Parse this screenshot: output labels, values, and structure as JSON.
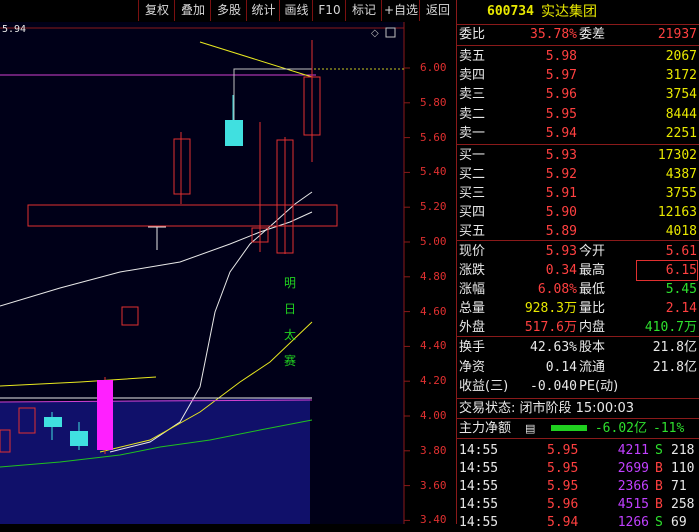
{
  "toolbar": {
    "buttons": [
      "复权",
      "叠加",
      "多股",
      "统计",
      "画线",
      "F10",
      "标记",
      "+自选",
      "返回"
    ]
  },
  "chart": {
    "current_price_label": "5.94",
    "price_ticks": [
      "6.00",
      "5.80",
      "5.60",
      "5.40",
      "5.20",
      "5.00",
      "4.80",
      "4.60",
      "4.40",
      "4.20",
      "4.00",
      "3.80",
      "3.60",
      "3.40"
    ],
    "annotation_chars": [
      "明",
      "日",
      "太",
      "赛"
    ]
  },
  "quote": {
    "code": "600734",
    "name": "实达集团",
    "weibi_label": "委比",
    "weibi_value": "35.78%",
    "weicha_label": "委差",
    "weicha_value": "21937",
    "asks": [
      {
        "label": "卖五",
        "price": "5.98",
        "vol": "2067"
      },
      {
        "label": "卖四",
        "price": "5.97",
        "vol": "3172"
      },
      {
        "label": "卖三",
        "price": "5.96",
        "vol": "3754"
      },
      {
        "label": "卖二",
        "price": "5.95",
        "vol": "8444"
      },
      {
        "label": "卖一",
        "price": "5.94",
        "vol": "2251"
      }
    ],
    "bids": [
      {
        "label": "买一",
        "price": "5.93",
        "vol": "17302"
      },
      {
        "label": "买二",
        "price": "5.92",
        "vol": "4387"
      },
      {
        "label": "买三",
        "price": "5.91",
        "vol": "3755"
      },
      {
        "label": "买四",
        "price": "5.90",
        "vol": "12163"
      },
      {
        "label": "买五",
        "price": "5.89",
        "vol": "4018"
      }
    ],
    "stats": [
      {
        "l1": "现价",
        "v1": "5.93",
        "l2": "今开",
        "v2": "5.61"
      },
      {
        "l1": "涨跌",
        "v1": "0.34",
        "l2": "最高",
        "v2": "6.15"
      },
      {
        "l1": "涨幅",
        "v1": "6.08%",
        "l2": "最低",
        "v2": "5.45"
      },
      {
        "l1": "总量",
        "v1": "928.3万",
        "l2": "量比",
        "v2": "2.14"
      },
      {
        "l1": "外盘",
        "v1": "517.6万",
        "l2": "内盘",
        "v2": "410.7万"
      }
    ],
    "fund": [
      {
        "l1": "换手",
        "v1": "42.63%",
        "l2": "股本",
        "v2": "21.8亿"
      },
      {
        "l1": "净资",
        "v1": "0.14",
        "l2": "流通",
        "v2": "21.8亿"
      },
      {
        "l1": "收益(三)",
        "v1": "-0.040",
        "l2": "PE(动)",
        "v2": ""
      }
    ],
    "trade_status": "交易状态: 闭市阶段 15:00:03",
    "main_flow_label": "主力净额",
    "main_flow_value": "-6.02亿",
    "main_flow_pct": "-11%",
    "ticks": [
      {
        "time": "14:55",
        "price": "5.95",
        "vol": "4211",
        "side": "S",
        "n": "218"
      },
      {
        "time": "14:55",
        "price": "5.95",
        "vol": "2699",
        "side": "B",
        "n": "110"
      },
      {
        "time": "14:55",
        "price": "5.95",
        "vol": "2366",
        "side": "B",
        "n": "71"
      },
      {
        "time": "14:55",
        "price": "5.96",
        "vol": "4515",
        "side": "B",
        "n": "258"
      },
      {
        "time": "14:55",
        "price": "5.94",
        "vol": "1266",
        "side": "S",
        "n": "69"
      }
    ]
  }
}
